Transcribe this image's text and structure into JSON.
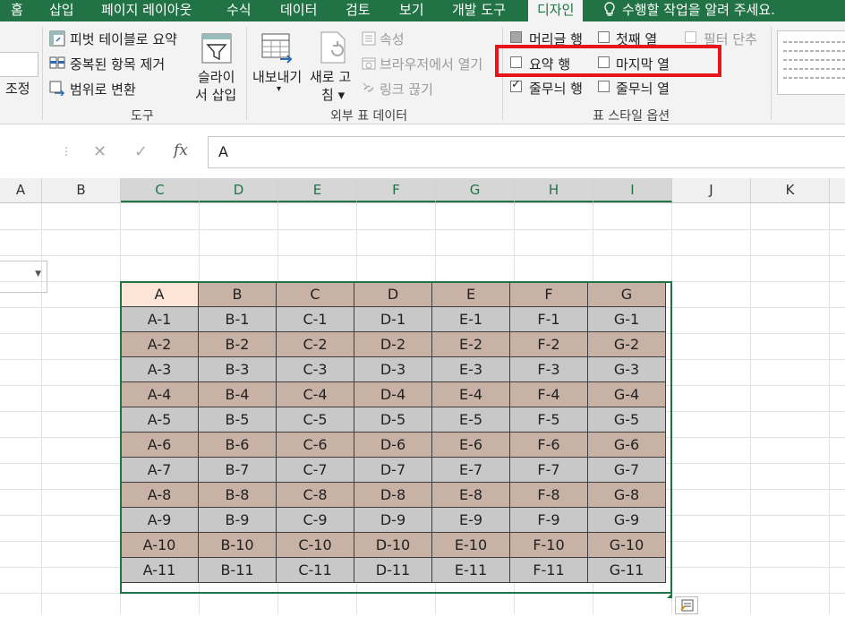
{
  "tabs": [
    "홈",
    "삽입",
    "페이지 레이아웃",
    "수식",
    "데이터",
    "검토",
    "보기",
    "개발 도구",
    "디자인",
    "수행할 작업을 알려 주세요."
  ],
  "ribbon": {
    "properties_partial": "조정",
    "tools": {
      "pivot": "피벗 테이블로 요약",
      "dedupe": "중복된 항목 제거",
      "convert": "범위로 변환",
      "slicer_line1": "슬라이",
      "slicer_line2": "서 삽입",
      "label": "도구"
    },
    "external": {
      "export_line1": "내보내기",
      "export_arrow": "▾",
      "refresh_line1": "새로 고",
      "refresh_line2": "침 ▾",
      "properties": "속성",
      "browser": "브라우저에서 열기",
      "unlink": "링크 끊기",
      "label": "외부 표 데이터"
    },
    "style_options": {
      "header_row": "머리글 행",
      "first_column": "첫째 열",
      "filter_button": "필터 단추",
      "total_row": "요약 행",
      "last_column": "마지막 열",
      "banded_rows": "줄무늬 행",
      "banded_columns": "줄무늬 열",
      "label": "표 스타일 옵션",
      "header_row_checked": false,
      "banded_rows_checked": true
    }
  },
  "formula": {
    "cancel": "✕",
    "enter": "✓",
    "fx": "fx",
    "value": "A"
  },
  "columns": [
    "A",
    "B",
    "C",
    "D",
    "E",
    "F",
    "G",
    "H",
    "I",
    "J",
    "K"
  ],
  "table": {
    "headers": [
      "A",
      "B",
      "C",
      "D",
      "E",
      "F",
      "G"
    ],
    "rows": [
      [
        "A-1",
        "B-1",
        "C-1",
        "D-1",
        "E-1",
        "F-1",
        "G-1"
      ],
      [
        "A-2",
        "B-2",
        "C-2",
        "D-2",
        "E-2",
        "F-2",
        "G-2"
      ],
      [
        "A-3",
        "B-3",
        "C-3",
        "D-3",
        "E-3",
        "F-3",
        "G-3"
      ],
      [
        "A-4",
        "B-4",
        "C-4",
        "D-4",
        "E-4",
        "F-4",
        "G-4"
      ],
      [
        "A-5",
        "B-5",
        "C-5",
        "D-5",
        "E-5",
        "F-5",
        "G-5"
      ],
      [
        "A-6",
        "B-6",
        "C-6",
        "D-6",
        "E-6",
        "F-6",
        "G-6"
      ],
      [
        "A-7",
        "B-7",
        "C-7",
        "D-7",
        "E-7",
        "F-7",
        "G-7"
      ],
      [
        "A-8",
        "B-8",
        "C-8",
        "D-8",
        "E-8",
        "F-8",
        "G-8"
      ],
      [
        "A-9",
        "B-9",
        "C-9",
        "D-9",
        "E-9",
        "F-9",
        "G-9"
      ],
      [
        "A-10",
        "B-10",
        "C-10",
        "D-10",
        "E-10",
        "F-10",
        "G-10"
      ],
      [
        "A-11",
        "B-11",
        "C-11",
        "D-11",
        "E-11",
        "F-11",
        "G-11"
      ]
    ]
  },
  "colors": {
    "accent": "#217346",
    "band_grey": "#c8c8c8",
    "band_brown": "#c8b2a6",
    "header_first": "#fce4d6",
    "highlight": "#e8141b"
  }
}
